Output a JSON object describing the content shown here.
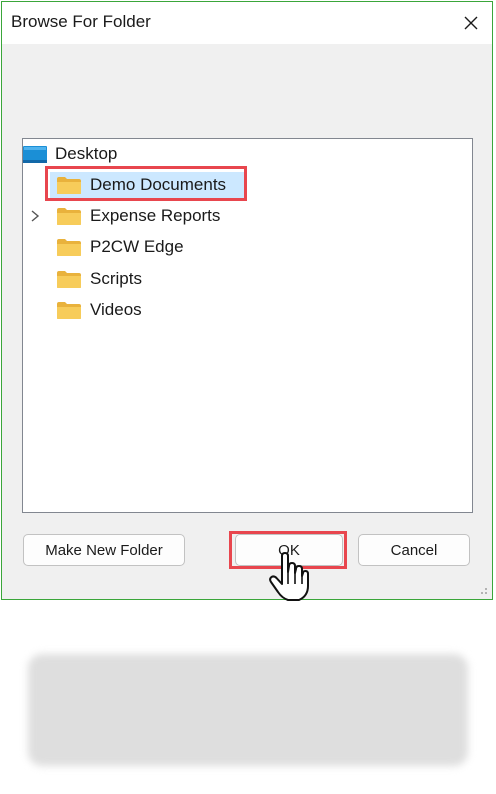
{
  "dialog": {
    "title": "Browse For Folder",
    "close_icon": "close-icon"
  },
  "tree": {
    "root": {
      "label": "Desktop",
      "icon": "desktop-icon"
    },
    "items": [
      {
        "label": "Demo Documents",
        "icon": "folder-icon",
        "selected": true
      },
      {
        "label": "Expense Reports",
        "icon": "folder-icon",
        "expandable": true
      },
      {
        "label": "P2CW Edge",
        "icon": "folder-icon"
      },
      {
        "label": "Scripts",
        "icon": "folder-icon"
      },
      {
        "label": "Videos",
        "icon": "folder-icon"
      }
    ]
  },
  "buttons": {
    "make_new_folder": "Make New Folder",
    "ok": "OK",
    "cancel": "Cancel"
  },
  "colors": {
    "highlight": "#e8464e",
    "selection": "#cce8ff",
    "dialog_border": "#3aa63a",
    "folder": "#f2c14e"
  },
  "cursor": {
    "icon": "hand-pointer-icon"
  }
}
